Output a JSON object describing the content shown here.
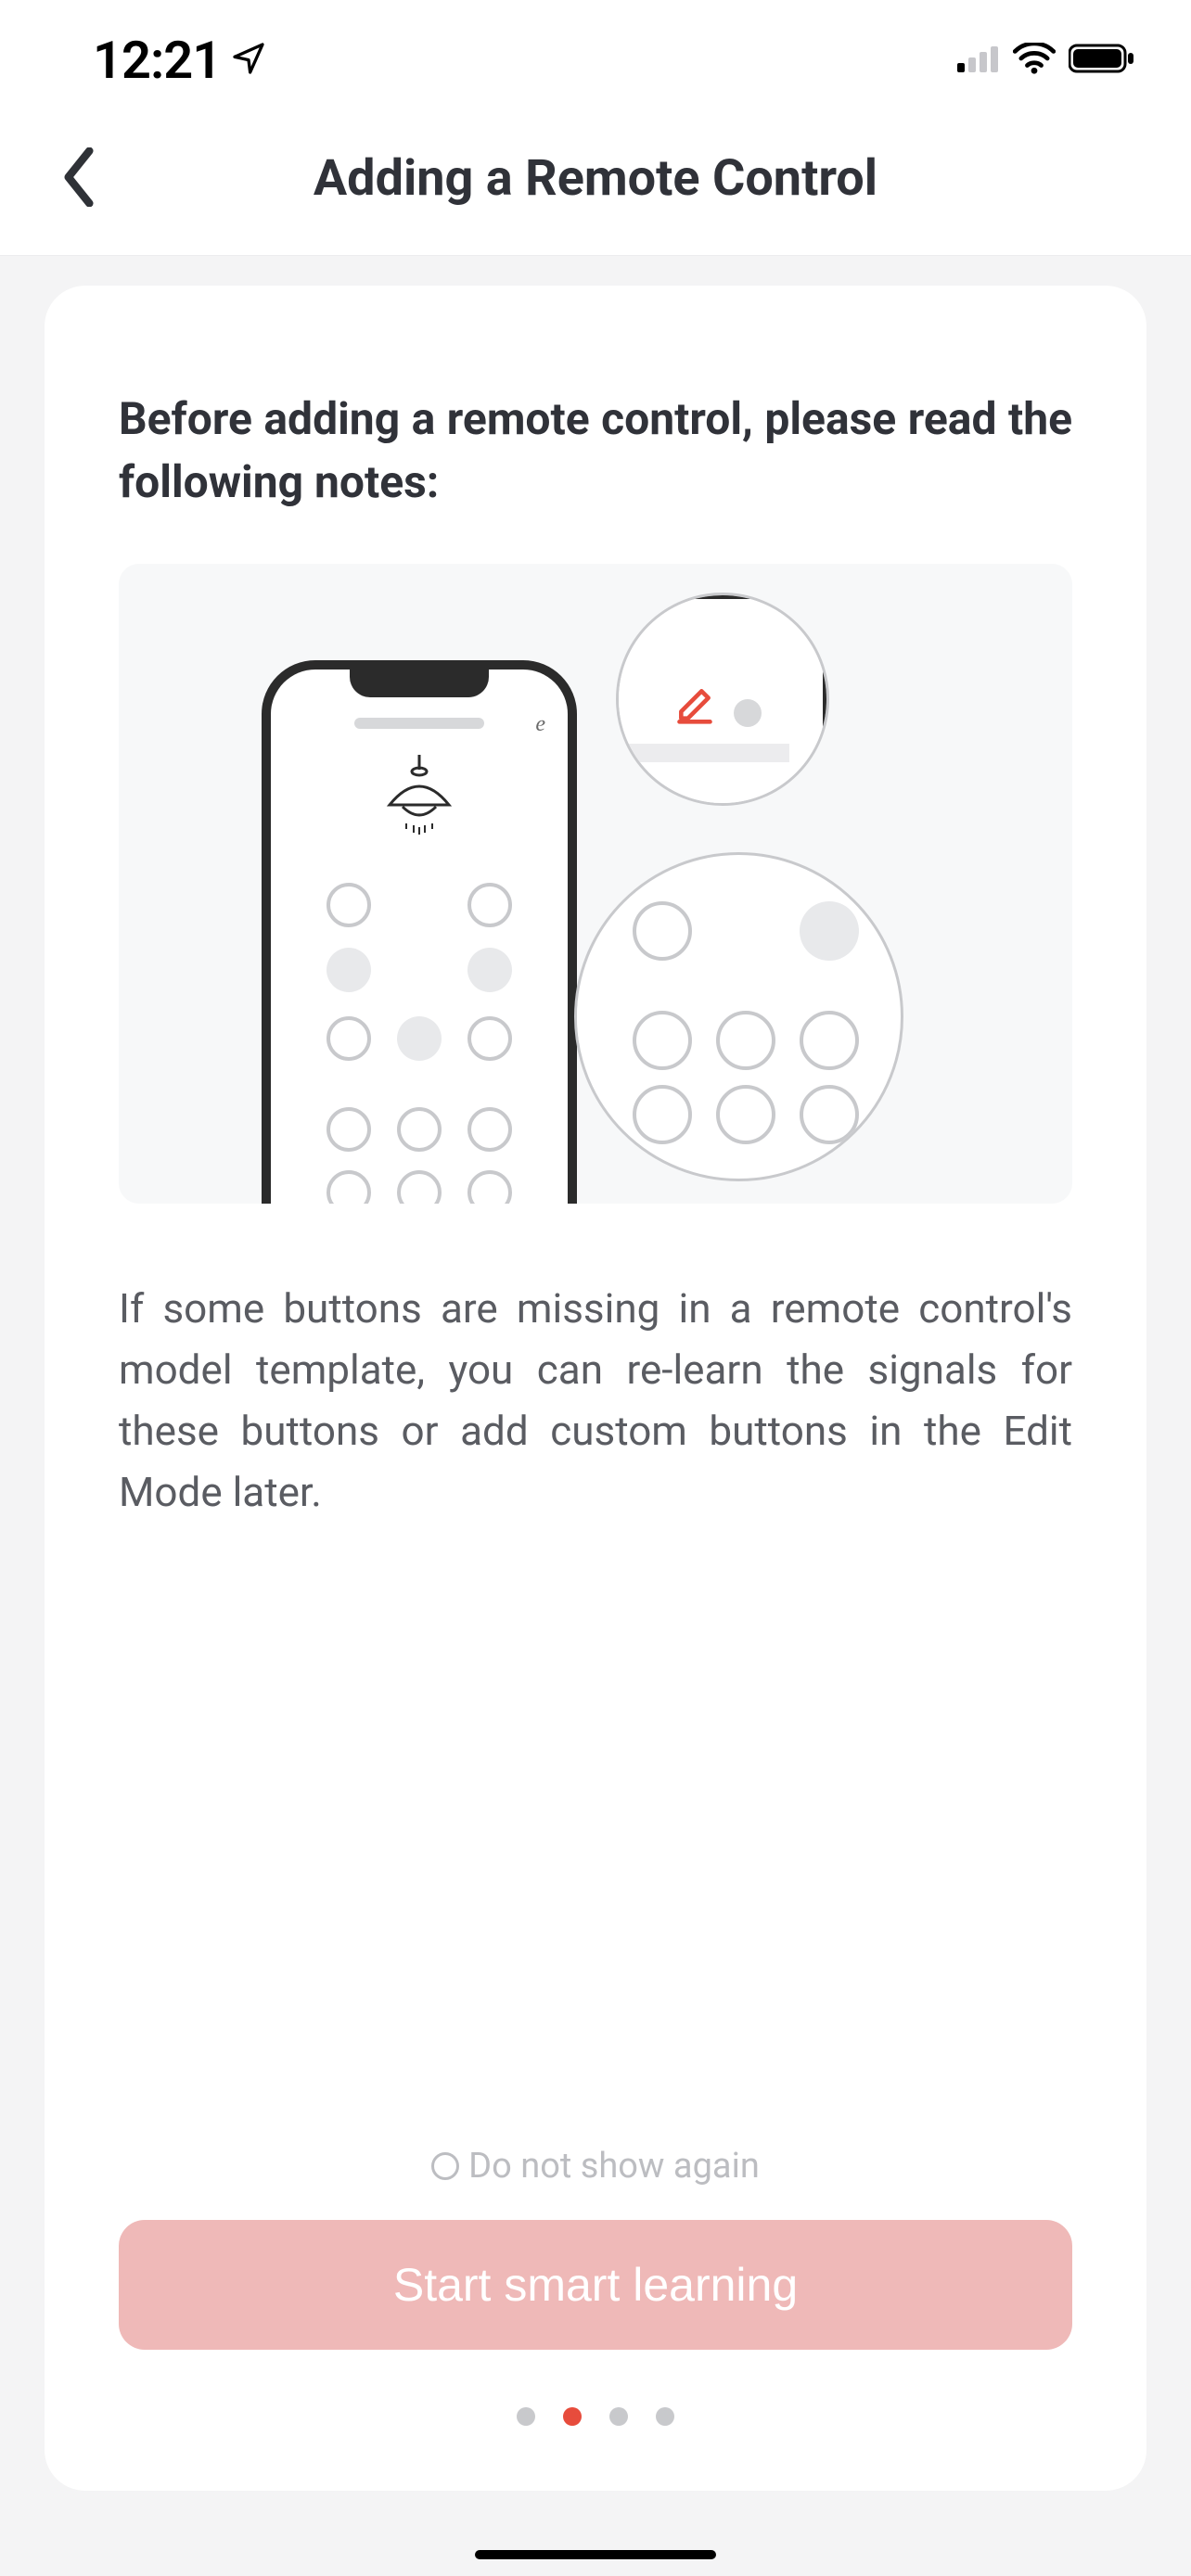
{
  "status": {
    "time": "12:21"
  },
  "header": {
    "title": "Adding a Remote Control"
  },
  "content": {
    "heading": "Before adding a remote control, please read the following notes:",
    "body": "If some buttons are missing in a remote control's model template, you can re-learn the signals for these buttons or add custom buttons in the Edit Mode later."
  },
  "doNotShow": {
    "label": "Do not show again",
    "checked": false
  },
  "cta": {
    "label": "Start smart learning"
  },
  "pager": {
    "count": 4,
    "activeIndex": 1
  }
}
